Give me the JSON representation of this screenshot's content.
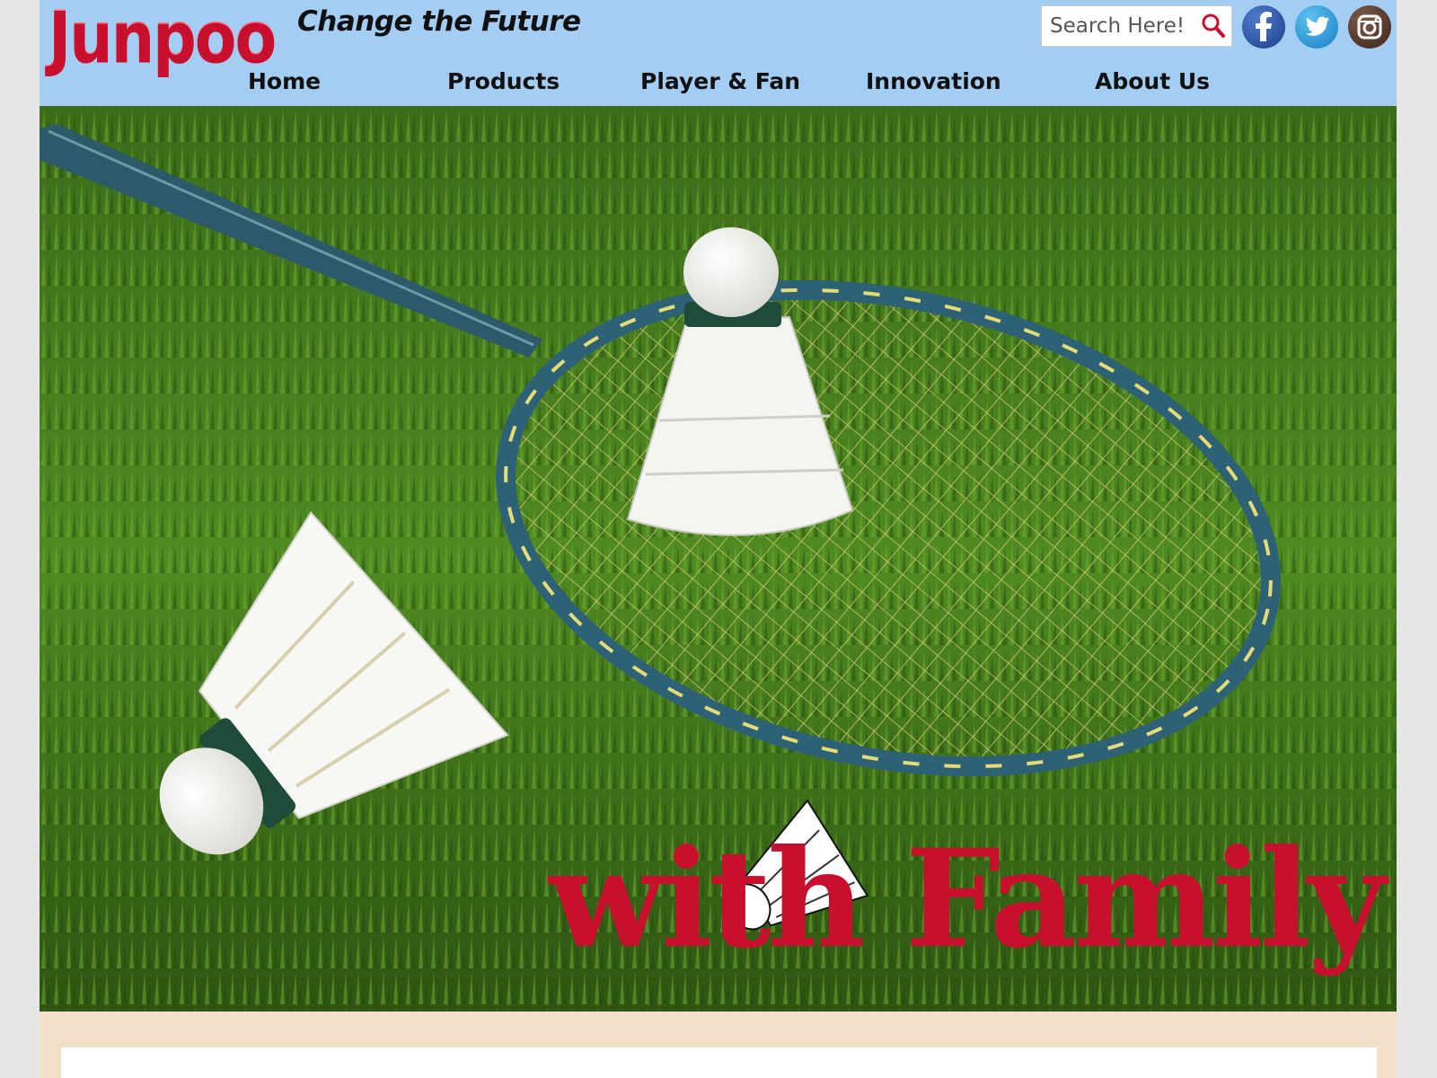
{
  "header": {
    "logo_text": "Junpoo",
    "tagline": "Change the Future",
    "search_placeholder": "Search Here!"
  },
  "nav": [
    {
      "label": "Home"
    },
    {
      "label": "Products"
    },
    {
      "label": "Player & Fan"
    },
    {
      "label": "Innovation"
    },
    {
      "label": "About Us"
    }
  ],
  "social": [
    {
      "name": "facebook",
      "icon": "facebook-icon"
    },
    {
      "name": "twitter",
      "icon": "twitter-icon"
    },
    {
      "name": "instagram",
      "icon": "instagram-icon"
    }
  ],
  "hero": {
    "overlay_text": "with Family",
    "image": "badminton racket and shuttlecocks on grass"
  },
  "colors": {
    "header_bg": "#a3cdf2",
    "brand_red": "#c8102e",
    "page_bg": "#f1dfc8"
  }
}
